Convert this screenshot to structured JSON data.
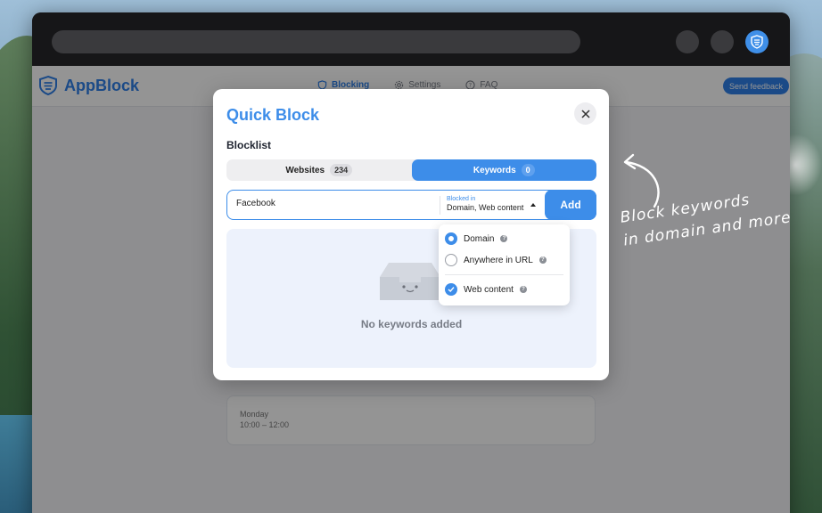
{
  "app": {
    "name": "AppBlock",
    "nav": [
      {
        "label": "Blocking",
        "icon": "shield-icon",
        "active": true
      },
      {
        "label": "Settings",
        "icon": "gear-icon",
        "active": false
      },
      {
        "label": "FAQ",
        "icon": "question-icon",
        "active": false
      }
    ],
    "feedback_label": "Send feedback"
  },
  "schedule": {
    "day": "Monday",
    "time": "10:00 – 12:00"
  },
  "modal": {
    "title": "Quick Block",
    "subtitle": "Blocklist",
    "tabs": [
      {
        "label": "Websites",
        "count": "234",
        "active": false
      },
      {
        "label": "Keywords",
        "count": "0",
        "active": true
      }
    ],
    "input_value": "Facebook",
    "blocked_in_label": "Blocked in",
    "blocked_in_value": "Domain, Web content",
    "add_label": "Add",
    "empty_text": "No keywords added"
  },
  "dropdown": {
    "options": [
      {
        "label": "Domain",
        "selected": true
      },
      {
        "label": "Anywhere in URL",
        "selected": false
      },
      {
        "label": "Web content",
        "selected": true
      }
    ]
  },
  "annotation": {
    "line1": "Block keywords",
    "line2": "in domain and more"
  },
  "colors": {
    "accent": "#3d8de9",
    "empty_bg": "#edf2fc"
  }
}
